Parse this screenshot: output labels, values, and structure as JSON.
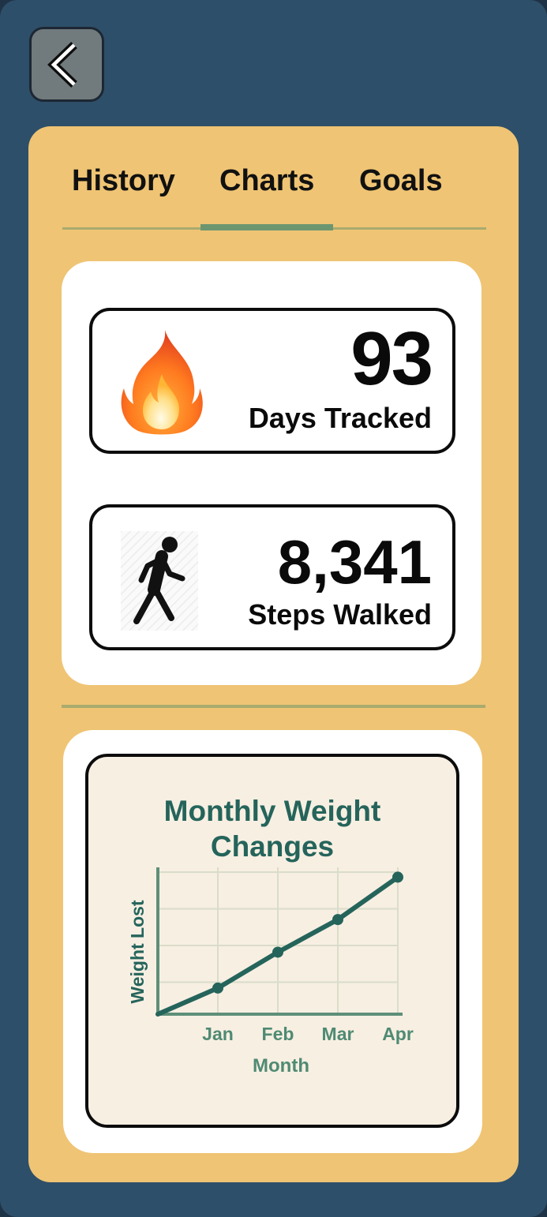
{
  "header": {
    "back_icon": "chevron-left-icon"
  },
  "tabs": [
    {
      "label": "History",
      "active": false
    },
    {
      "label": "Charts",
      "active": true
    },
    {
      "label": "Goals",
      "active": false
    }
  ],
  "stats": [
    {
      "value": "93",
      "label": "Days Tracked",
      "icon": "fire-icon"
    },
    {
      "value": "8,341",
      "label": "Steps Walked",
      "icon": "walking-person-icon"
    }
  ],
  "colors": {
    "background": "#2e4f69",
    "panel": "#efc474",
    "accent": "#25645b",
    "tab_indicator": "#6b9670"
  },
  "chart_data": {
    "type": "line",
    "title_line1": "Monthly Weight",
    "title_line2": "Changes",
    "xlabel": "Month",
    "ylabel": "Weight Lost",
    "categories": [
      "",
      "Jan",
      "Feb",
      "Mar",
      "Apr"
    ],
    "values": [
      0,
      0.8,
      1.9,
      2.9,
      4.2
    ],
    "ylim": [
      0,
      4.5
    ],
    "grid": true
  }
}
